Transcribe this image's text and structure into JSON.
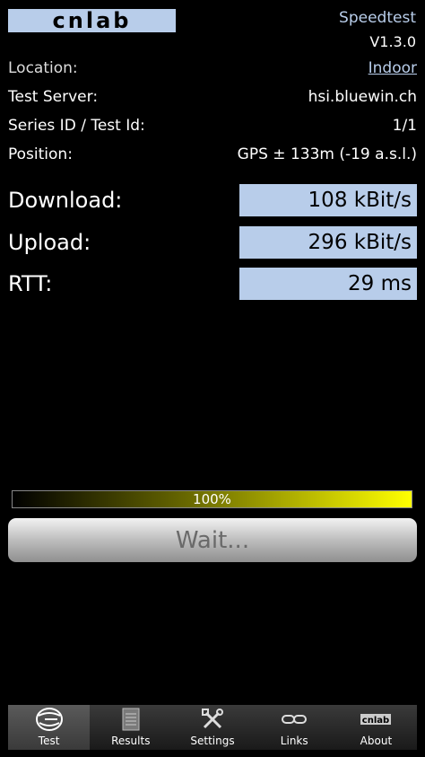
{
  "header": {
    "logo_text": "cnlab",
    "app_title": "Speedtest",
    "version": "V1.3.0"
  },
  "info": {
    "location_label": "Location:",
    "location_value": "Indoor",
    "server_label": "Test Server:",
    "server_value": "hsi.bluewin.ch",
    "series_label": "Series ID / Test Id:",
    "series_value": "1/1",
    "position_label": "Position:",
    "position_value": "GPS ± 133m (-19 a.s.l.)"
  },
  "metrics": {
    "download_label": "Download:",
    "download_value": "108 kBit/s",
    "upload_label": "Upload:",
    "upload_value": "296 kBit/s",
    "rtt_label": "RTT:",
    "rtt_value": "29 ms"
  },
  "progress": {
    "text": "100%",
    "fraction": 1.0
  },
  "action": {
    "button_label": "Wait..."
  },
  "tabs": [
    {
      "label": "Test",
      "icon": "speed-test-icon",
      "active": true
    },
    {
      "label": "Results",
      "icon": "results-list-icon",
      "active": false
    },
    {
      "label": "Settings",
      "icon": "settings-tools-icon",
      "active": false
    },
    {
      "label": "Links",
      "icon": "link-chain-icon",
      "active": false
    },
    {
      "label": "About",
      "icon": "cnlab-logo-icon",
      "active": false
    }
  ],
  "colors": {
    "accent": "#b8cdea",
    "progress_end": "#ffff00"
  }
}
